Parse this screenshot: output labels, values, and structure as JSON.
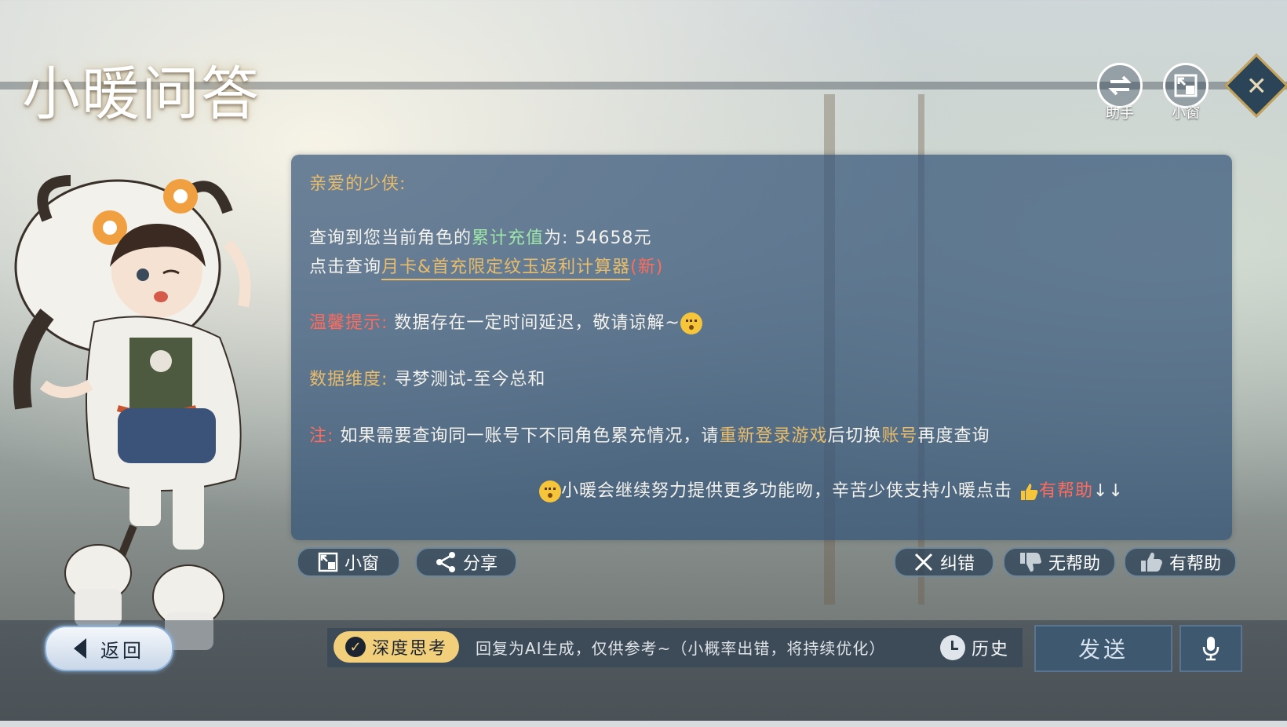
{
  "header": {
    "title": "小暖问答",
    "assistant_label": "助手",
    "mini_window_label": "小窗"
  },
  "message": {
    "greeting": "亲爱的少侠:",
    "line1_prefix": "查询到您当前角色的",
    "line1_highlight": "累计充值",
    "line1_suffix": "为:",
    "line1_value": "54658元",
    "line2_prefix": "点击查询",
    "line2_link": "月卡&首充限定纹玉返利计算器",
    "line2_new": "(新)",
    "tip_label": "温馨提示:",
    "tip_text": "数据存在一定时间延迟，敬请谅解~",
    "dimension_label": "数据维度:",
    "dimension_value": "寻梦测试-至今总和",
    "note_label": "注:",
    "note_text1": "如果需要查询同一账号下不同角色累充情况，请",
    "note_highlight1": "重新登录游戏",
    "note_text2": "后切换",
    "note_highlight2": "账号",
    "note_text3": "再度查询",
    "footer_text": "小暖会继续努力提供更多功能吻，辛苦少侠支持小暖点击",
    "footer_highlight": "有帮助",
    "footer_arrows": "↓↓"
  },
  "actions": {
    "mini_window": "小窗",
    "share": "分享",
    "correct": "纠错",
    "not_helpful": "无帮助",
    "helpful": "有帮助"
  },
  "bottom": {
    "back": "返回",
    "deep_think": "深度思考",
    "input_placeholder": "回复为AI生成，仅供参考~（小概率出错，将持续优化）",
    "history": "历史",
    "send": "发送"
  },
  "colors": {
    "gold": "#e9bc6b",
    "green": "#9fe5a8",
    "red": "#ff6b5c",
    "card": "#345578"
  },
  "icons": [
    "swap-icon",
    "mini-window-icon",
    "close-icon",
    "share-icon",
    "x-icon",
    "thumbs-down-icon",
    "thumbs-up-icon",
    "back-triangle-icon",
    "check-icon",
    "clock-icon",
    "mic-icon",
    "emoji-icon"
  ]
}
